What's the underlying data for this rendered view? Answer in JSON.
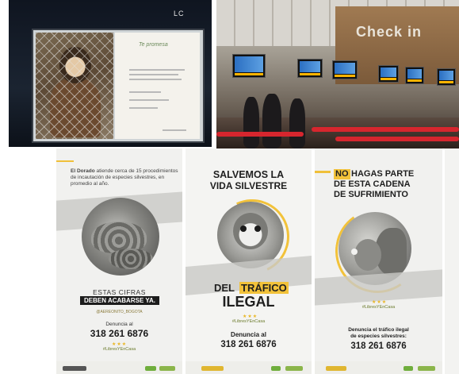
{
  "top_left": {
    "poster_title": "Te promesa",
    "stadium_text": "LC"
  },
  "top_right": {
    "sign": "Check in"
  },
  "poster1": {
    "intro_bold": "El Dorado",
    "intro_rest": "atiende cerca de 15 procedimientos de incautación de especies silvestres, en promedio al año.",
    "line1": "ESTAS CIFRAS",
    "line2": "DEBEN ACABARSE YA.",
    "handle": "@AEREONITO_BOGOTA",
    "denuncia": "Denuncia al",
    "phone": "318 261 6876",
    "hashtag": "#LibresYEnCasa"
  },
  "poster2": {
    "title1": "SALVEMOS LA",
    "title2": "VIDA SILVESTRE",
    "del": "DEL",
    "trafico": "TRÁFICO",
    "ilegal": "ILEGAL",
    "hashtag": "#LibresYEnCasa",
    "denuncia": "Denuncia al",
    "phone": "318 261 6876"
  },
  "poster3": {
    "no": "NO",
    "title1_rest": "HAGAS PARTE",
    "title2": "DE ESTA CADENA",
    "title3": "DE SUFRIMIENTO",
    "hashtag": "#LibresYEnCasa",
    "denuncia1": "Denuncia el tráfico ilegal",
    "denuncia2": "de especies silvestres:",
    "phone": "318 261 6876"
  },
  "colors": {
    "accent_yellow": "#f2c23a",
    "rope_red": "#d6262e"
  }
}
